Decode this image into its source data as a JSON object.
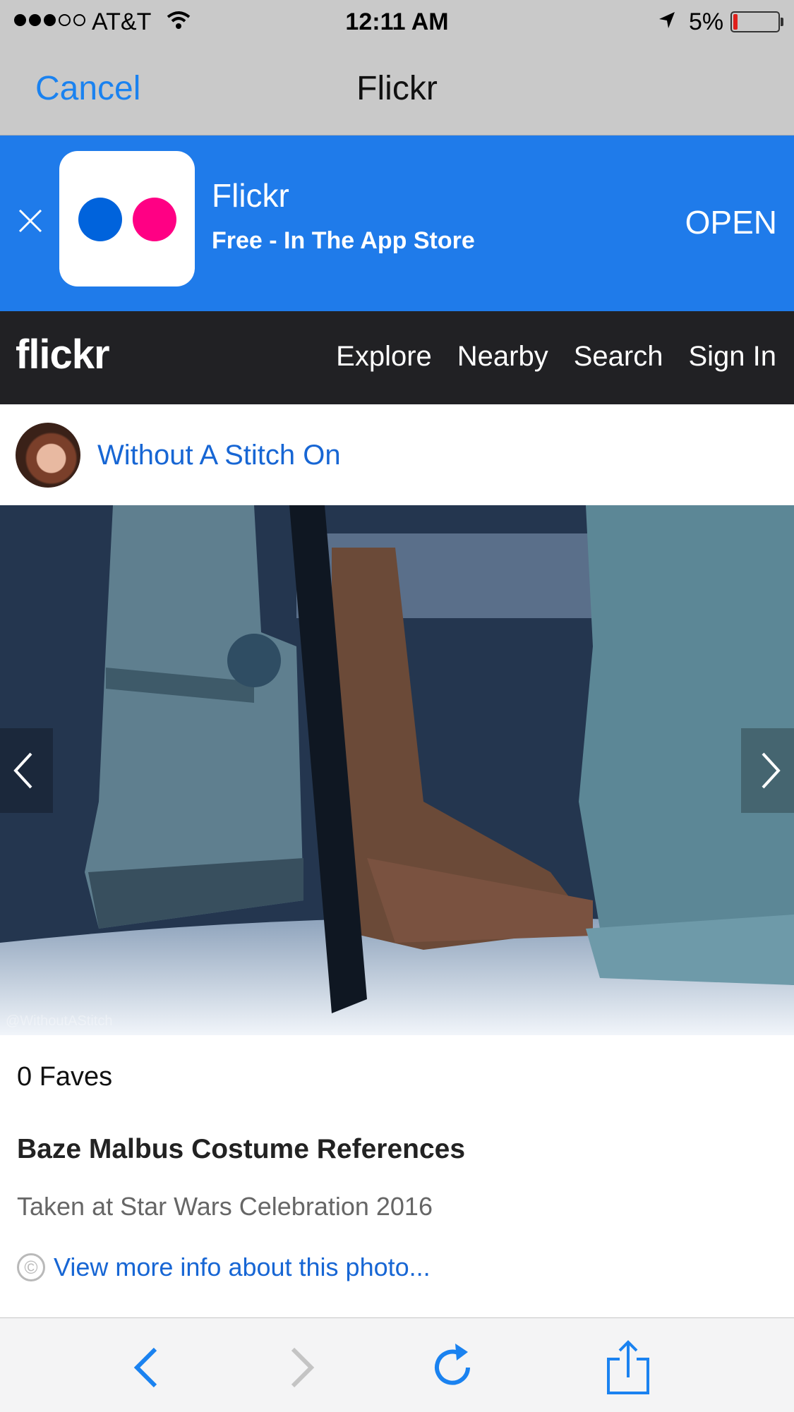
{
  "status_bar": {
    "carrier": "AT&T",
    "time": "12:11 AM",
    "battery_percent": "5%"
  },
  "navbar": {
    "cancel_label": "Cancel",
    "title": "Flickr"
  },
  "app_banner": {
    "app_name": "Flickr",
    "subtitle": "Free - In The App Store",
    "open_label": "OPEN",
    "icon_colors": {
      "blue": "#0063dc",
      "pink": "#ff0084"
    }
  },
  "site_header": {
    "logo": "flickr",
    "nav": [
      "Explore",
      "Nearby",
      "Search",
      "Sign In"
    ]
  },
  "photo_page": {
    "owner_name": "Without A Stitch On",
    "watermark": "@WithoutAStitch",
    "faves": "0 Faves",
    "title": "Baze Malbus Costume References",
    "description": "Taken at Star Wars Celebration 2016",
    "more_info_link": "View more info about this photo..."
  },
  "toolbar": {
    "icons": [
      "back-icon",
      "forward-icon",
      "reload-icon",
      "share-icon"
    ]
  },
  "colors": {
    "ios_blue": "#1a82f0",
    "banner_blue": "#1f7bea",
    "header_dark": "#212124",
    "link_blue": "#1766d4"
  }
}
